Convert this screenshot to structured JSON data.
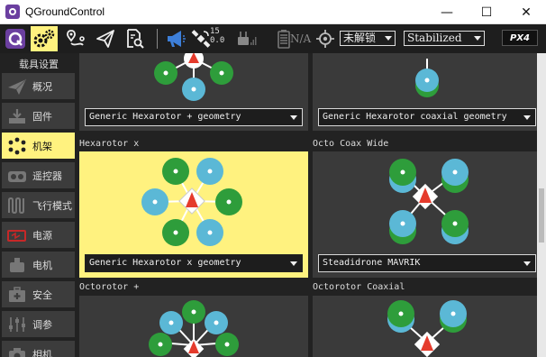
{
  "window": {
    "title": "QGroundControl",
    "minimize": "—",
    "maximize": "☐",
    "close": "✕"
  },
  "toolbar": {
    "gps_count": "15",
    "gps_hdop": "0.0",
    "battery": "N/A",
    "arm_status": "未解锁",
    "flight_mode": "Stabilized",
    "logo": "PX4"
  },
  "sidebar": {
    "header": "载具设置",
    "items": [
      {
        "label": "概况",
        "icon": "paper-plane-icon"
      },
      {
        "label": "固件",
        "icon": "firmware-download-icon"
      },
      {
        "label": "机架",
        "icon": "airframe-icon"
      },
      {
        "label": "遥控器",
        "icon": "radio-controller-icon"
      },
      {
        "label": "飞行模式",
        "icon": "flight-modes-icon"
      },
      {
        "label": "电源",
        "icon": "battery-icon"
      },
      {
        "label": "电机",
        "icon": "motor-icon"
      },
      {
        "label": "安全",
        "icon": "medkit-icon"
      },
      {
        "label": "调参",
        "icon": "sliders-icon"
      },
      {
        "label": "相机",
        "icon": "camera-icon"
      }
    ]
  },
  "airframes": [
    {
      "title": "",
      "selection": "Generic Hexarotor + geometry"
    },
    {
      "title": "",
      "selection": "Generic Hexarotor coaxial geometry"
    },
    {
      "title": "Hexarotor x",
      "selection": "Generic Hexarotor x geometry"
    },
    {
      "title": "Octo Coax Wide",
      "selection": "Steadidrone MAVRIK"
    },
    {
      "title": "Octorotor +",
      "selection": ""
    },
    {
      "title": "Octorotor Coaxial",
      "selection": ""
    }
  ],
  "colors": {
    "selected": "#fff27f",
    "motor_green": "#2e9d3b",
    "motor_blue": "#5bb8d6",
    "arrow_red": "#e53b2c"
  }
}
